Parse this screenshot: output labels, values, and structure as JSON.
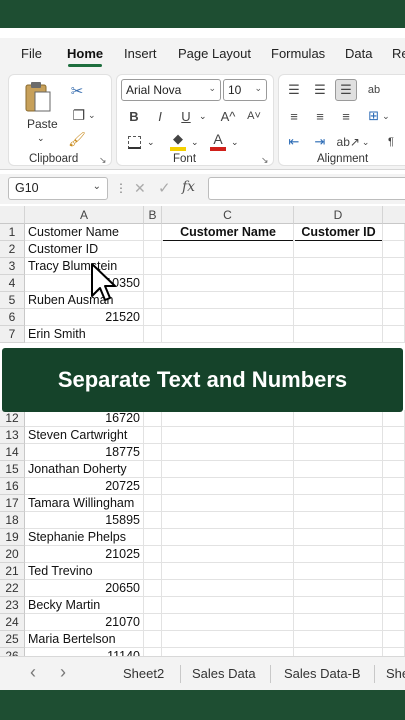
{
  "menu": {
    "tabs": [
      "File",
      "Home",
      "Insert",
      "Page Layout",
      "Formulas",
      "Data",
      "Re"
    ],
    "active": "Home"
  },
  "ribbon": {
    "clipboard": {
      "paste_label": "Paste",
      "group_label": "Clipboard"
    },
    "font": {
      "font_name": "Arial Nova",
      "font_size": "10",
      "bold": "B",
      "italic": "I",
      "underline": "U",
      "grow": "A^",
      "shrink": "A˅",
      "fill_color": "#f5d000",
      "font_color_letter": "A",
      "font_color": "#d0201a",
      "group_label": "Font"
    },
    "alignment": {
      "group_label": "Alignment",
      "wrap": "ab",
      "pilcrow": "¶"
    }
  },
  "formula_bar": {
    "name_box": "G10",
    "cancel": "✕",
    "enter": "✓",
    "fx": "fx",
    "value": ""
  },
  "columns": [
    "A",
    "B",
    "C",
    "D"
  ],
  "headers": {
    "c": "Customer Name",
    "d": "Customer ID"
  },
  "rows": [
    {
      "n": "1",
      "a": "Customer Name",
      "t": "txt"
    },
    {
      "n": "2",
      "a": "Customer ID",
      "t": "txt"
    },
    {
      "n": "3",
      "a": "Tracy Blumstein",
      "t": "txt"
    },
    {
      "n": "4",
      "a": "10350",
      "t": "num"
    },
    {
      "n": "5",
      "a": "Ruben Ausman",
      "t": "txt"
    },
    {
      "n": "6",
      "a": "21520",
      "t": "num"
    },
    {
      "n": "7",
      "a": "Erin Smith",
      "t": "txt"
    },
    {
      "n": "12",
      "a": "16720",
      "t": "num"
    },
    {
      "n": "13",
      "a": "Steven Cartwright",
      "t": "txt"
    },
    {
      "n": "14",
      "a": "18775",
      "t": "num"
    },
    {
      "n": "15",
      "a": "Jonathan Doherty",
      "t": "txt"
    },
    {
      "n": "16",
      "a": "20725",
      "t": "num"
    },
    {
      "n": "17",
      "a": "Tamara Willingham",
      "t": "txt"
    },
    {
      "n": "18",
      "a": "15895",
      "t": "num"
    },
    {
      "n": "19",
      "a": "Stephanie Phelps",
      "t": "txt"
    },
    {
      "n": "20",
      "a": "21025",
      "t": "num"
    },
    {
      "n": "21",
      "a": "Ted Trevino",
      "t": "txt"
    },
    {
      "n": "22",
      "a": "20650",
      "t": "num"
    },
    {
      "n": "23",
      "a": "Becky Martin",
      "t": "txt"
    },
    {
      "n": "24",
      "a": "21070",
      "t": "num"
    },
    {
      "n": "25",
      "a": "Maria Bertelson",
      "t": "txt"
    },
    {
      "n": "26",
      "a": "11140",
      "t": "num"
    }
  ],
  "banner": {
    "text": "Separate Text and Numbers"
  },
  "sheets": {
    "prev": "‹",
    "next": "›",
    "tabs": [
      "Sheet2",
      "Sales Data",
      "Sales Data-B",
      "She"
    ]
  }
}
